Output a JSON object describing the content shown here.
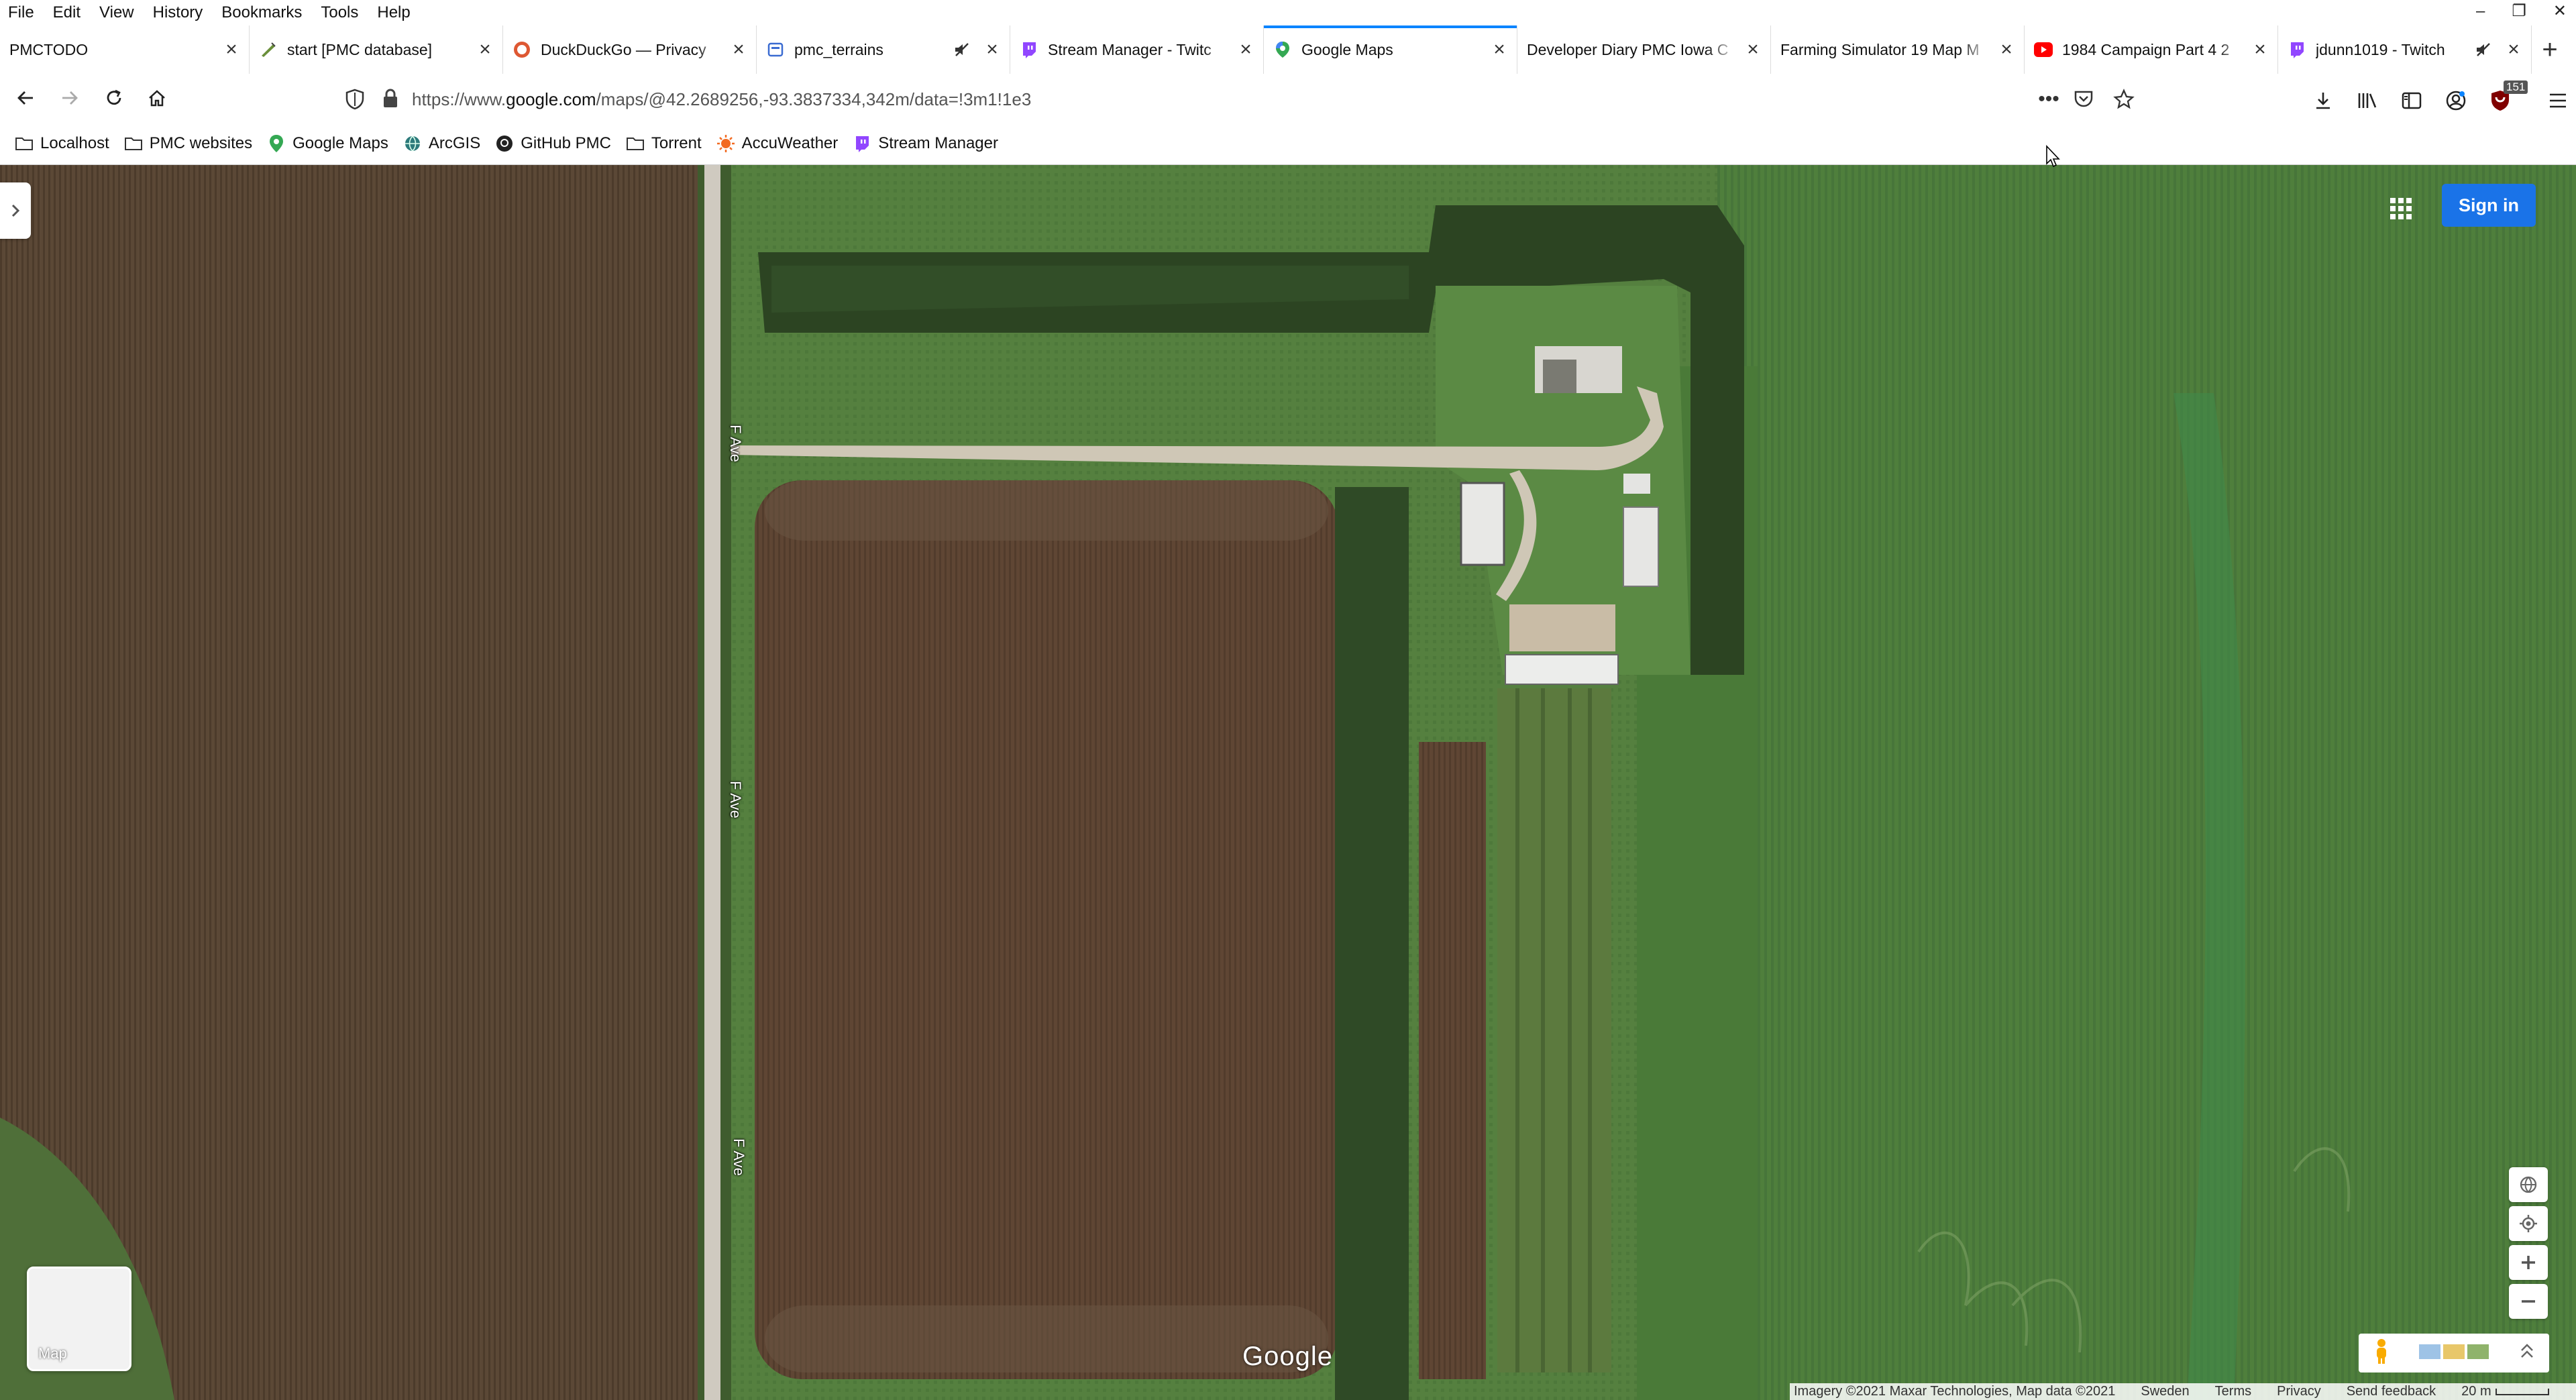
{
  "menubar": {
    "items": [
      "File",
      "Edit",
      "View",
      "History",
      "Bookmarks",
      "Tools",
      "Help"
    ]
  },
  "tabs": [
    {
      "title": "PMCTODO",
      "icon": "none",
      "active": false,
      "muted": false
    },
    {
      "title": "start [PMC database]",
      "icon": "wiki-icon",
      "active": false,
      "muted": false
    },
    {
      "title": "DuckDuckGo — Privacy",
      "icon": "duckduckgo-icon",
      "active": false,
      "muted": false
    },
    {
      "title": "pmc_terrains",
      "icon": "page-icon",
      "active": false,
      "muted": true
    },
    {
      "title": "Stream Manager - Twitc",
      "icon": "twitch-icon",
      "active": false,
      "muted": false
    },
    {
      "title": "Google Maps",
      "icon": "maps-pin-icon",
      "active": true,
      "muted": false
    },
    {
      "title": "Developer Diary PMC Iowa C",
      "icon": "none",
      "active": false,
      "muted": false
    },
    {
      "title": "Farming Simulator 19 Map M",
      "icon": "none",
      "active": false,
      "muted": false
    },
    {
      "title": "1984 Campaign Part 4 2",
      "icon": "youtube-icon",
      "active": false,
      "muted": false
    },
    {
      "title": "jdunn1019 - Twitch",
      "icon": "twitch-icon",
      "active": false,
      "muted": true
    }
  ],
  "navbar": {
    "url_prefix": "https://www.",
    "url_domain": "google.com",
    "url_rest": "/maps/@42.2689256,-93.3837334,342m/data=!3m1!1e3",
    "badge_count": "151"
  },
  "bookmarks": [
    {
      "label": "Localhost",
      "icon": "folder-icon"
    },
    {
      "label": "PMC websites",
      "icon": "folder-icon"
    },
    {
      "label": "Google Maps",
      "icon": "maps-pin-icon"
    },
    {
      "label": "ArcGIS",
      "icon": "globe-icon"
    },
    {
      "label": "GitHub PMC",
      "icon": "github-icon"
    },
    {
      "label": "Torrent",
      "icon": "folder-icon"
    },
    {
      "label": "AccuWeather",
      "icon": "sun-icon"
    },
    {
      "label": "Stream Manager",
      "icon": "twitch-icon"
    }
  ],
  "map": {
    "sign_in": "Sign in",
    "road_labels": [
      "F Ave",
      "F Ave",
      "F Ave"
    ],
    "layer_label": "Map",
    "logo": "Google",
    "attribution": {
      "imagery": "Imagery ©2021 Maxar Technologies, Map data ©2021",
      "country": "Sweden",
      "terms": "Terms",
      "privacy": "Privacy",
      "feedback": "Send feedback",
      "scale": "20 m"
    }
  },
  "colors": {
    "accent": "#0a84ff",
    "signin_blue": "#1a73e8",
    "field_brown": "#5a4632",
    "grass_green": "#4d7a3a"
  }
}
